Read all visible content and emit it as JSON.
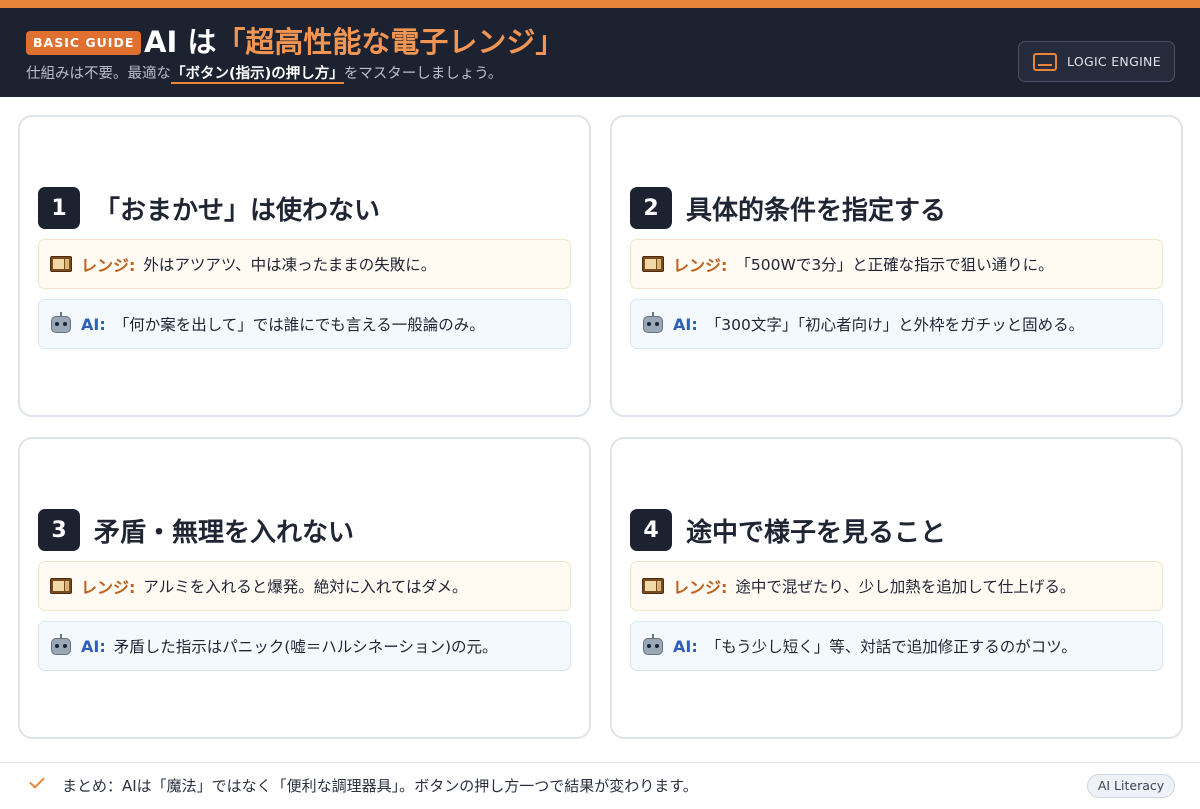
{
  "header": {
    "badge": "BASIC GUIDE",
    "title_prefix": "AI は",
    "title_accent": "「超高性能な電子レンジ」",
    "subtitle_before": "仕組みは不要。最適な",
    "subtitle_em": "「ボタン(指示)の押し方」",
    "subtitle_after": "をマスターしましょう。",
    "engine_label": "LOGIC ENGINE"
  },
  "labels": {
    "range": "レンジ:",
    "ai": "AI:"
  },
  "icons": {
    "range": "microwave-icon",
    "ai": "robot-icon",
    "engine": "monitor-icon",
    "summary": "checkmark-icon"
  },
  "cards": [
    {
      "num": "1",
      "title": "「おまかせ」は使わない",
      "range_text": "外はアツアツ、中は凍ったままの失敗に。",
      "ai_text": "「何か案を出して」では誰にでも言える一般論のみ。"
    },
    {
      "num": "2",
      "title": "具体的条件を指定する",
      "range_text": "「500Wで3分」と正確な指示で狙い通りに。",
      "ai_text": "「300文字」「初心者向け」と外枠をガチッと固める。"
    },
    {
      "num": "3",
      "title": "矛盾・無理を入れない",
      "range_text": "アルミを入れると爆発。絶対に入れてはダメ。",
      "ai_text": "矛盾した指示はパニック(嘘＝ハルシネーション)の元。"
    },
    {
      "num": "4",
      "title": "途中で様子を見ること",
      "range_text": "途中で混ぜたり、少し加熱を追加して仕上げる。",
      "ai_text": "「もう少し短く」等、対話で追加修正するのがコツ。"
    }
  ],
  "footer": {
    "summary": "まとめ：AIは「魔法」ではなく「便利な調理器具」。ボタンの押し方一つで結果が変わります。",
    "tag": "AI Literacy"
  },
  "colors": {
    "accent": "#e8853a",
    "dark": "#1d2231",
    "range_label": "#c0601f",
    "ai_label": "#2f5fb8"
  }
}
